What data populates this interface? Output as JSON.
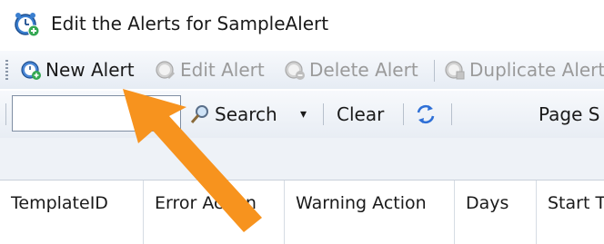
{
  "window": {
    "title": "Edit the Alerts for SampleAlert",
    "icon": "alarm-clock-icon"
  },
  "toolbar": {
    "new_alert": "New Alert",
    "edit_alert": "Edit Alert",
    "delete_alert": "Delete Alert",
    "duplicate_alert": "Duplicate Alert"
  },
  "search_bar": {
    "input_value": "",
    "search_label": "Search",
    "clear_label": "Clear",
    "page_size_label": "Page S"
  },
  "grid": {
    "columns": [
      "TemplateID",
      "Error Action",
      "Warning Action",
      "Days",
      "Start Ti"
    ]
  },
  "colors": {
    "accent_arrow": "#f7931e",
    "toolbar_bg": "#e6ecf4",
    "disabled_text": "#9a9a9a"
  }
}
